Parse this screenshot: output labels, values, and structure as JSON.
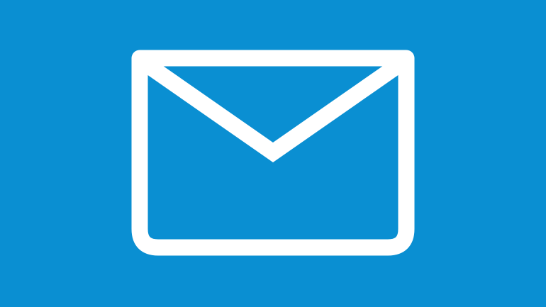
{
  "background": {
    "color": "#0a8fd2"
  },
  "icon": {
    "name": "mail-envelope-icon",
    "stroke_color": "#ffffff"
  }
}
